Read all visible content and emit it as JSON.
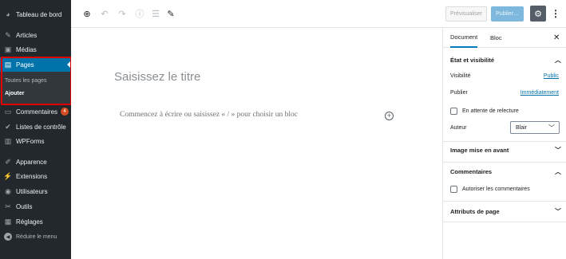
{
  "sidebar": {
    "items": [
      {
        "icon": "dashboard-icon",
        "glyph": "◕",
        "label": "Tableau de bord"
      },
      {
        "icon": "pin-icon",
        "glyph": "✎",
        "label": "Articles"
      },
      {
        "icon": "media-icon",
        "glyph": "▣",
        "label": "Médias"
      },
      {
        "icon": "pages-icon",
        "glyph": "▤",
        "label": "Pages",
        "active": true
      },
      {
        "icon": "comments-icon",
        "glyph": "▭",
        "label": "Commentaires",
        "badge": "4"
      },
      {
        "icon": "checklist-icon",
        "glyph": "✔",
        "label": "Listes de contrôle"
      },
      {
        "icon": "forms-icon",
        "glyph": "▥",
        "label": "WPForms"
      },
      {
        "icon": "appearance-icon",
        "glyph": "✐",
        "label": "Apparence"
      },
      {
        "icon": "plugins-icon",
        "glyph": "⚡",
        "label": "Extensions"
      },
      {
        "icon": "users-icon",
        "glyph": "◉",
        "label": "Utilisateurs"
      },
      {
        "icon": "tools-icon",
        "glyph": "✂",
        "label": "Outils"
      },
      {
        "icon": "settings-icon",
        "glyph": "▦",
        "label": "Réglages"
      },
      {
        "icon": "collapse-icon",
        "glyph": "◀",
        "label": "Réduire le menu"
      }
    ],
    "submenu": [
      {
        "label": "Toutes les pages"
      },
      {
        "label": "Ajouter",
        "current": true
      }
    ]
  },
  "toolbar": {
    "add_block_glyph": "⊕",
    "undo_glyph": "↶",
    "redo_glyph": "↷",
    "info_glyph": "ⓘ",
    "outline_glyph": "☰",
    "tools_glyph": "✎",
    "preview_label": "Prévisualiser",
    "publish_label": "Publier…",
    "settings_glyph": "⚙",
    "more_glyph": "⋮"
  },
  "editor": {
    "title_placeholder": "Saisissez le titre",
    "block_placeholder": "Commencez à écrire ou saisissez « / » pour choisir un bloc",
    "add_block_glyph": "+"
  },
  "settings_panel": {
    "tabs": [
      "Document",
      "Bloc"
    ],
    "close_glyph": "✕",
    "status": {
      "heading": "État et visibilité",
      "visibility_label": "Visibilité",
      "visibility_value": "Public",
      "publish_label": "Publier",
      "publish_value": "Immédiatement",
      "pending_review_label": "En attente de relecture",
      "author_label": "Auteur",
      "author_value": "Blair"
    },
    "featured_image": {
      "heading": "Image mise en avant"
    },
    "comments": {
      "heading": "Commentaires",
      "allow_label": "Autoriser les commentaires"
    },
    "page_attributes": {
      "heading": "Attributs de page"
    },
    "chevron_up": "︿",
    "chevron_down": "﹀"
  },
  "colors": {
    "sidebar_bg": "#23282d",
    "active_menu": "#0073aa",
    "highlight": "#e00000",
    "badge": "#d54e21",
    "link": "#0073aa"
  }
}
